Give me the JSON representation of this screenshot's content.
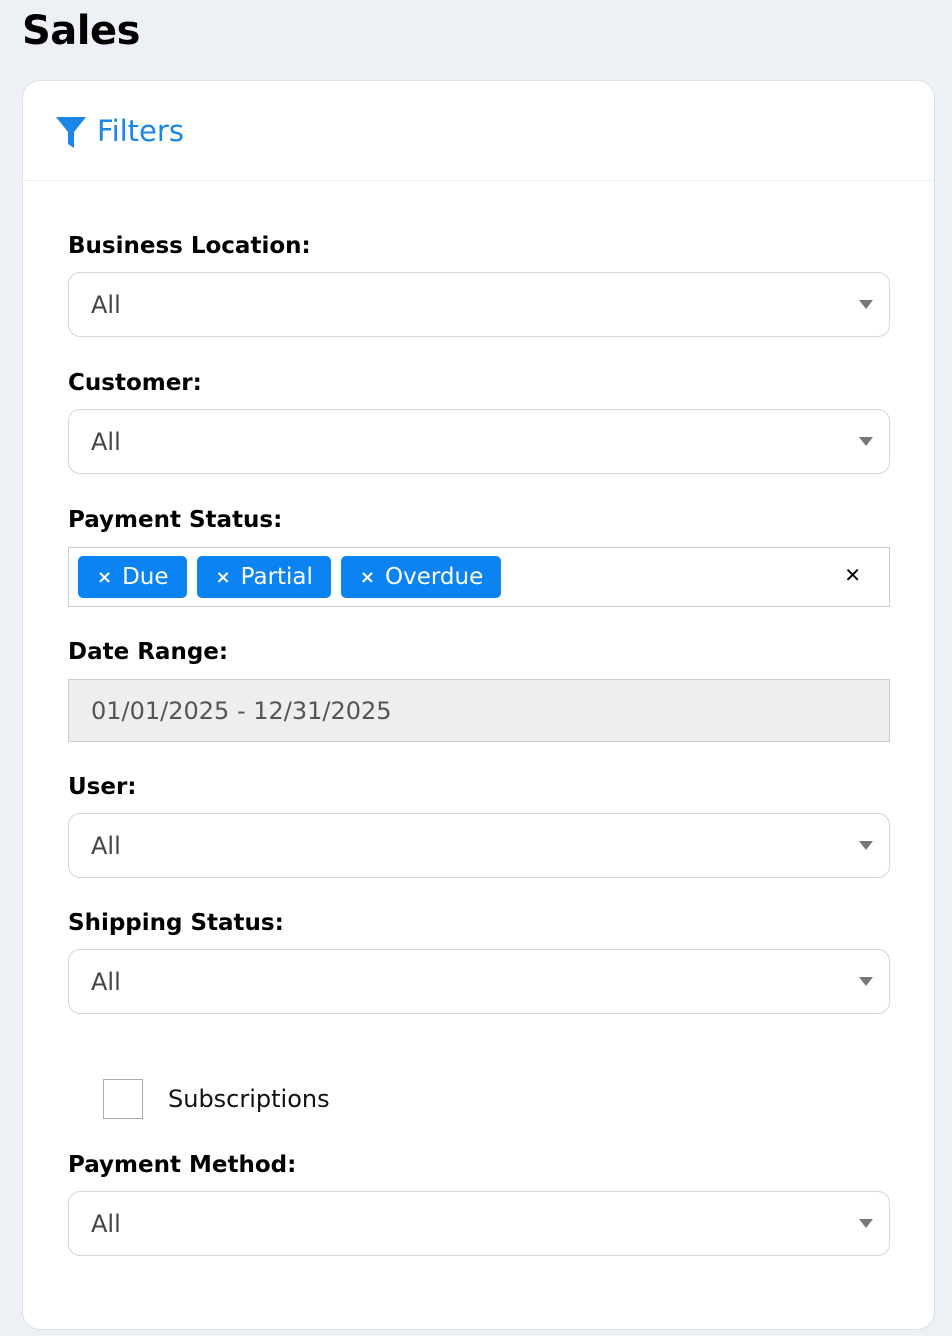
{
  "page": {
    "title": "Sales"
  },
  "filters": {
    "title": "Filters",
    "business_location": {
      "label": "Business Location:",
      "value": "All"
    },
    "customer": {
      "label": "Customer:",
      "value": "All"
    },
    "payment_status": {
      "label": "Payment Status:",
      "tags": [
        "Due",
        "Partial",
        "Overdue"
      ],
      "tag_remove_glyph": "×",
      "clear_glyph": "✕"
    },
    "date_range": {
      "label": "Date Range:",
      "value": "01/01/2025 - 12/31/2025"
    },
    "user": {
      "label": "User:",
      "value": "All"
    },
    "shipping_status": {
      "label": "Shipping Status:",
      "value": "All"
    },
    "subscriptions": {
      "label": "Subscriptions",
      "checked": false
    },
    "payment_method": {
      "label": "Payment Method:",
      "value": "All"
    }
  },
  "colors": {
    "accent": "#1a86e8",
    "tag_bg": "#0b83f2",
    "page_bg": "#edf0f5"
  },
  "icons": {
    "filter": "filter-icon",
    "dropdown": "chevron-down-icon"
  }
}
